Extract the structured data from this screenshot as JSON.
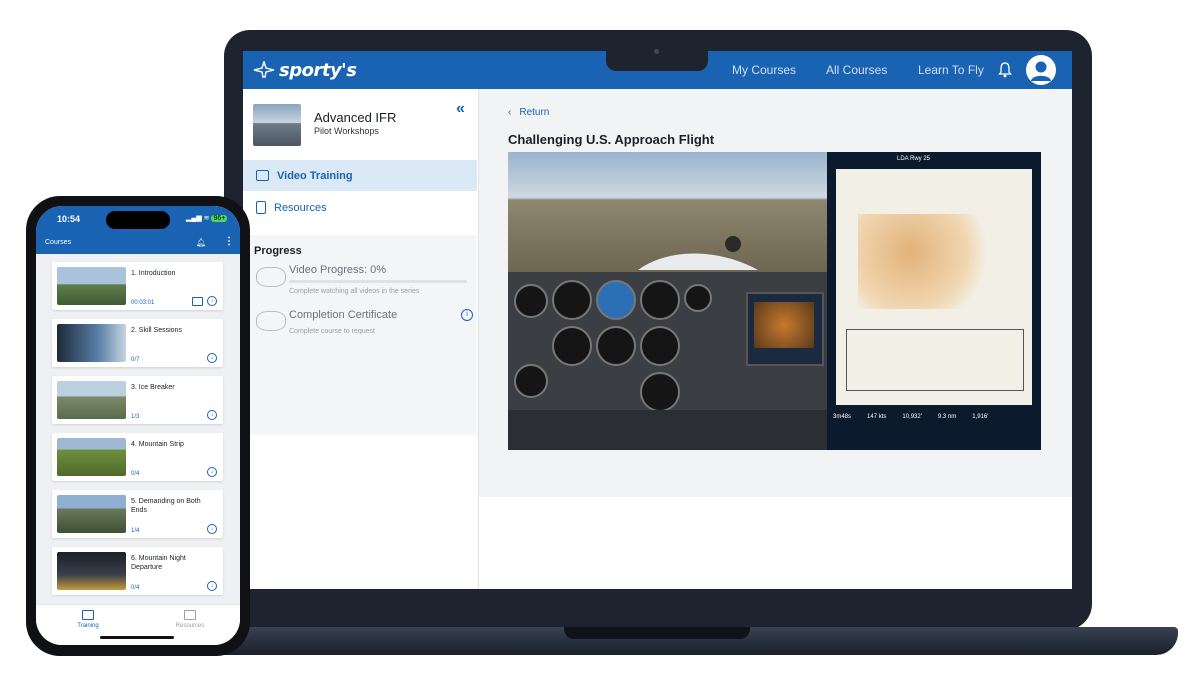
{
  "laptop": {
    "brand": "sporty's",
    "nav": {
      "my_courses": "My Courses",
      "all_courses": "All Courses",
      "learn_to_fly": "Learn To Fly"
    },
    "course": {
      "title": "Advanced IFR",
      "subtitle": "Pilot Workshops"
    },
    "sidebar_items": [
      {
        "label": "Video Training",
        "icon": "video-icon",
        "active": true
      },
      {
        "label": "Resources",
        "icon": "bookmark-icon",
        "active": false
      }
    ],
    "progress": {
      "heading": "Progress",
      "video_label": "Video Progress: 0%",
      "video_value": 0,
      "video_hint": "Complete watching all videos in the series",
      "certificate_label": "Completion Certificate",
      "certificate_hint": "Complete course to request"
    },
    "main": {
      "return_label": "Return",
      "lesson_title": "Challenging U.S. Approach Flight",
      "chart_header": "LDA Rwy 25",
      "status_values": [
        "3m48s",
        "147 kts",
        "10,932'",
        "9.3 nm",
        "1,916'"
      ]
    }
  },
  "phone": {
    "time": "10:54",
    "battery": "96+",
    "header_title": "Courses",
    "lessons": [
      {
        "name": "1. Introduction",
        "meta": "00:03:01",
        "cast": true
      },
      {
        "name": "2. Skill Sessions",
        "meta": "0/7",
        "cast": false
      },
      {
        "name": "3. Ice Breaker",
        "meta": "1/3",
        "cast": false
      },
      {
        "name": "4. Mountain Strip",
        "meta": "0/4",
        "cast": false
      },
      {
        "name": "5. Demanding on Both Ends",
        "meta": "1/4",
        "cast": false
      },
      {
        "name": "6. Mountain Night Departure",
        "meta": "0/4",
        "cast": false
      }
    ],
    "tabs": [
      {
        "label": "Training",
        "active": true
      },
      {
        "label": "Resources",
        "active": false
      }
    ]
  },
  "colors": {
    "brand_blue": "#1a63b3",
    "active_row": "#dbe8f6",
    "device_frame": "#1d2430"
  }
}
